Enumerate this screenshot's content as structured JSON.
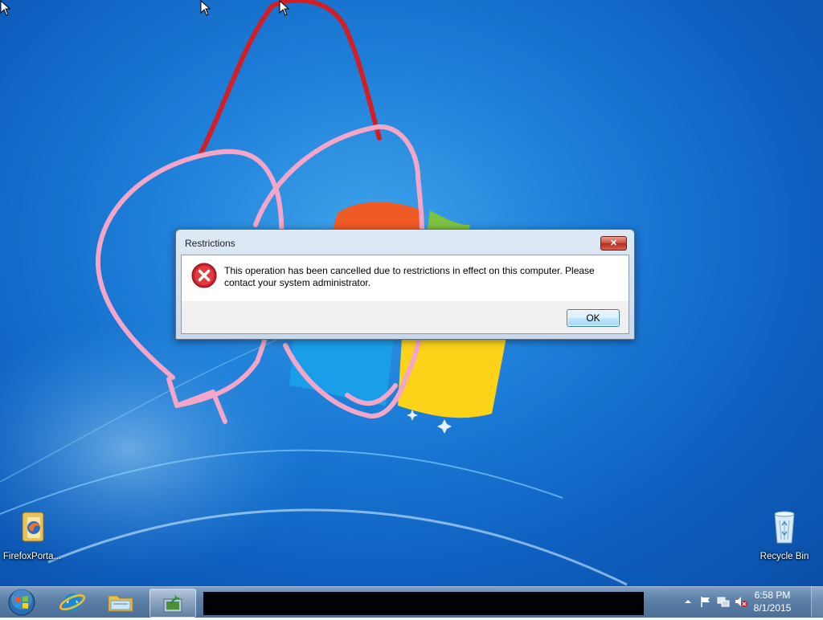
{
  "colors": {
    "desktop_blue": "#1d7ed8",
    "annotation_red": "#d21f25",
    "annotation_pink": "#f4a6c8"
  },
  "desktop": {
    "icons": [
      {
        "label": "FirefoxPorta...",
        "icon": "firefox-portable-icon"
      },
      {
        "label": "Recycle Bin",
        "icon": "recycle-bin-icon"
      }
    ]
  },
  "dialog": {
    "title": "Restrictions",
    "close_label": "✕",
    "icon": "error-icon",
    "message_line1": "This operation has been cancelled due to restrictions in effect on this computer. Please",
    "message_line2": "contact your system administrator.",
    "ok_label": "OK"
  },
  "taskbar": {
    "pinned": [
      {
        "name": "internet-explorer",
        "icon": "internet-explorer-icon"
      },
      {
        "name": "windows-explorer",
        "icon": "folder-icon"
      },
      {
        "name": "program",
        "icon": "program-icon"
      }
    ],
    "tray": {
      "time": "6:58 PM",
      "date": "8/1/2015",
      "icons": [
        "show-hidden-icons-arrow",
        "action-center-flag-icon",
        "network-icon",
        "volume-muted-icon"
      ]
    }
  }
}
